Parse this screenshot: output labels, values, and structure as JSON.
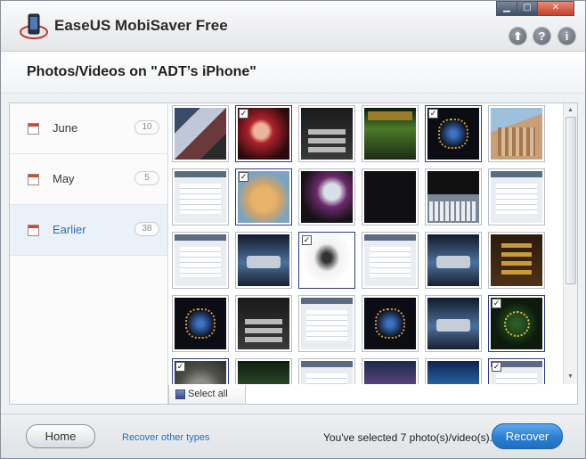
{
  "window": {
    "title": "EaseUS MobiSaver Free",
    "controls": {
      "minimize": "▁",
      "maximize": "▢",
      "close": "✕"
    },
    "top_buttons": [
      {
        "name": "upgrade-button",
        "icon": "up-arrow-icon",
        "glyph": "⬆"
      },
      {
        "name": "help-button",
        "icon": "help-icon",
        "glyph": "?"
      },
      {
        "name": "info-button",
        "icon": "info-icon",
        "glyph": "i"
      }
    ]
  },
  "header": {
    "title": "Photos/Videos on \"ADT’s iPhone\""
  },
  "sidebar": {
    "items": [
      {
        "label": "June",
        "count": "10",
        "selected": false
      },
      {
        "label": "May",
        "count": "5",
        "selected": false
      },
      {
        "label": "Earlier",
        "count": "38",
        "selected": true
      }
    ]
  },
  "grid": {
    "rows": [
      [
        {
          "style": "collage",
          "checked": false
        },
        {
          "style": "redface",
          "checked": true
        },
        {
          "style": "dark-menu",
          "checked": false
        },
        {
          "style": "green",
          "checked": false
        },
        {
          "style": "ornate",
          "checked": true
        },
        {
          "style": "bldg",
          "checked": false
        }
      ],
      [
        {
          "style": "screen",
          "checked": false
        },
        {
          "style": "dog",
          "checked": true
        },
        {
          "style": "robot",
          "checked": false
        },
        {
          "style": "black",
          "checked": false
        },
        {
          "style": "keyboard",
          "checked": false
        },
        {
          "style": "screen",
          "checked": false
        }
      ],
      [
        {
          "style": "screen",
          "checked": false
        },
        {
          "style": "blue-dialog",
          "checked": false
        },
        {
          "style": "sketch",
          "checked": true
        },
        {
          "style": "screen",
          "checked": false
        },
        {
          "style": "blue-dialog",
          "checked": false
        },
        {
          "style": "wood",
          "checked": false
        }
      ],
      [
        {
          "style": "ornate",
          "checked": false
        },
        {
          "style": "dark-menu",
          "checked": false
        },
        {
          "style": "screen",
          "checked": false
        },
        {
          "style": "ornate",
          "checked": false
        },
        {
          "style": "blue-dialog",
          "checked": false
        },
        {
          "style": "gold",
          "checked": true
        }
      ],
      [
        {
          "style": "cat",
          "checked": true
        },
        {
          "style": "dark-green",
          "checked": false
        },
        {
          "style": "screen",
          "checked": false
        },
        {
          "style": "game",
          "checked": false
        },
        {
          "style": "water",
          "checked": false
        },
        {
          "style": "screen",
          "checked": true
        }
      ]
    ],
    "select_all_label": "Select all"
  },
  "footer": {
    "home_label": "Home",
    "recover_other_label": "Recover other types",
    "status": "You've selected 7 photo(s)/video(s).",
    "recover_label": "Recover"
  },
  "colors": {
    "accent": "#2b7fd2",
    "link": "#2a6fb6",
    "selected_bg": "#eaf1f8"
  }
}
